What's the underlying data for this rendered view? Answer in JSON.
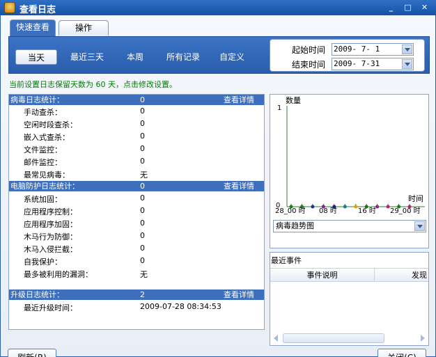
{
  "window": {
    "title": "查看日志",
    "min_icon": "_",
    "max_icon": "□",
    "close_icon": "✕"
  },
  "tabs": [
    {
      "label": "快速查看",
      "active": true
    },
    {
      "label": "操作",
      "active": false
    }
  ],
  "range_buttons": [
    "当天",
    "最近三天",
    "本周",
    "所有记录",
    "自定义"
  ],
  "selected_range": "当天",
  "date_range": {
    "start_label": "起始时间",
    "start_value": "2009- 7- 1",
    "end_label": "结束时间",
    "end_value": "2009- 7-31"
  },
  "hint": "当前设置日志保留天数为 60 天，点击修改设置。",
  "sections": {
    "virus": {
      "title": "病毒日志统计：",
      "value": "0",
      "link": "查看详情",
      "rows": [
        {
          "label": "手动查杀：",
          "value": "0"
        },
        {
          "label": "空闲时段查杀：",
          "value": "0"
        },
        {
          "label": "嵌入式查杀：",
          "value": "0"
        },
        {
          "label": "文件监控：",
          "value": "0"
        },
        {
          "label": "邮件监控：",
          "value": "0"
        },
        {
          "label": "最常见病毒：",
          "value": "无"
        }
      ]
    },
    "protect": {
      "title": "电脑防护日志统计：",
      "value": "0",
      "link": "查看详情",
      "rows": [
        {
          "label": "系统加固：",
          "value": "0"
        },
        {
          "label": "应用程序控制：",
          "value": "0"
        },
        {
          "label": "应用程序加固：",
          "value": "0"
        },
        {
          "label": "木马行为防御：",
          "value": "0"
        },
        {
          "label": "木马入侵拦截：",
          "value": "0"
        },
        {
          "label": "自我保护：",
          "value": "0"
        },
        {
          "label": "最多被利用的漏洞：",
          "value": "无"
        }
      ]
    },
    "upgrade": {
      "title": "升级日志统计：",
      "value": "2",
      "link": "查看详情",
      "rows": [
        {
          "label": "最近升级时间：",
          "value": "2009-07-28 08:34:53"
        }
      ]
    }
  },
  "chart_data": {
    "type": "line",
    "ylabel": "数量",
    "xlabel": "时间",
    "ylim": [
      0,
      1
    ],
    "y_ticks": [
      "1",
      "0"
    ],
    "x_tick_labels": [
      "28_00 时",
      "08 时",
      "16 时",
      "29_00 时"
    ],
    "series_colors": [
      "#1f7a1f",
      "#1f7a1f",
      "#2a2a9a",
      "#8b1f8b",
      "#1f1f8b",
      "#1f7a7a",
      "#e0a000",
      "#1f6f1f",
      "#8b1f8b",
      "#c0206a",
      "#1f7a1f",
      "#c0206a"
    ],
    "x": [
      0,
      2,
      4,
      6,
      8,
      10,
      12,
      14,
      16,
      18,
      20,
      22
    ],
    "values": [
      0,
      0,
      0,
      0,
      0,
      0,
      0,
      0,
      0,
      0,
      0,
      0
    ]
  },
  "chart_selector": "病毒趋势图",
  "events": {
    "title": "最近事件",
    "col_desc": "事件说明",
    "col_found": "发现"
  },
  "buttons": {
    "refresh": "刷新(R)",
    "close": "关闭(C)"
  }
}
